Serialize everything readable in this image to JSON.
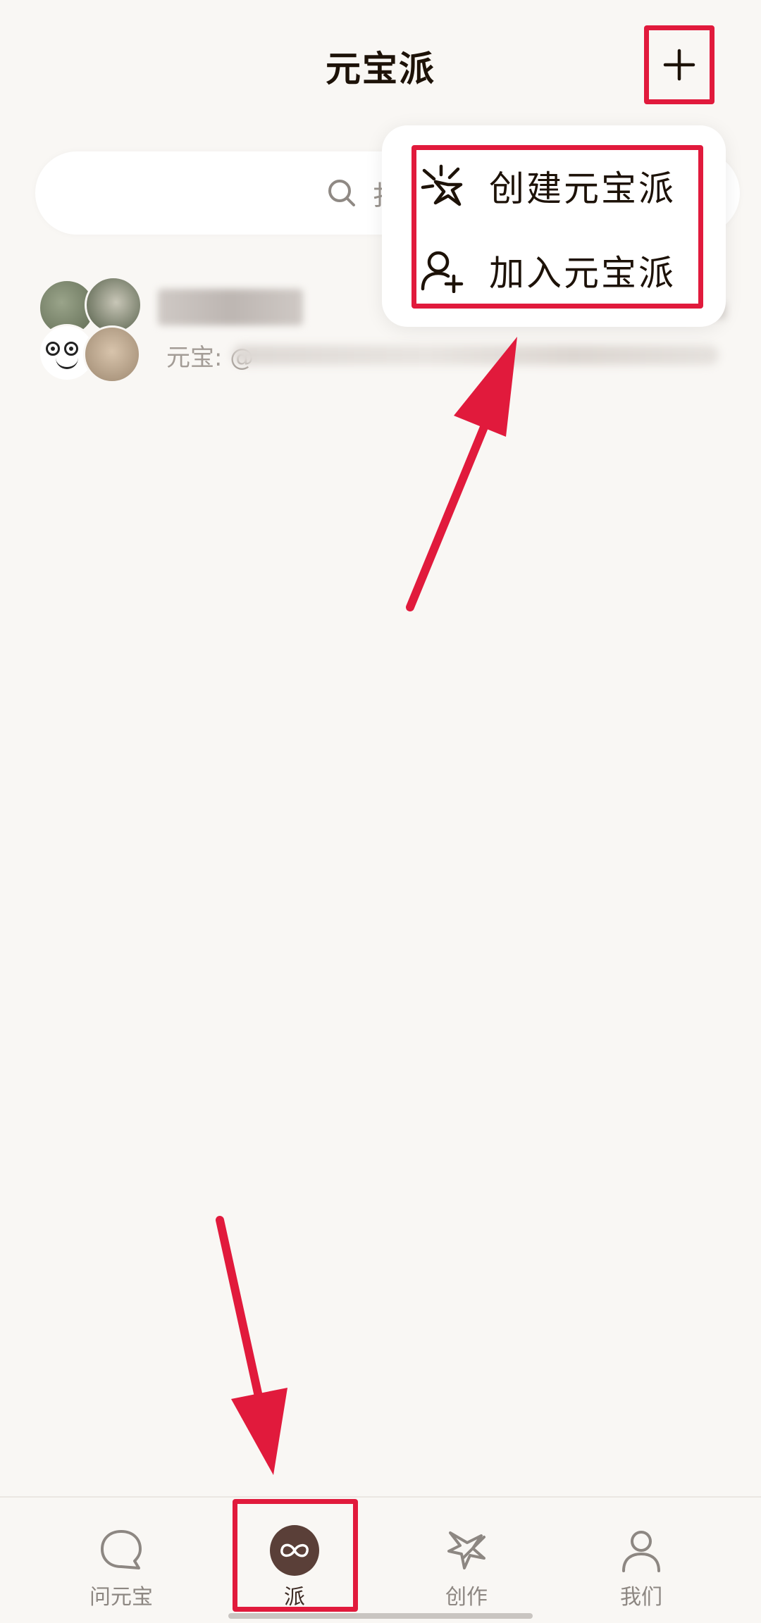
{
  "header": {
    "title": "元宝派",
    "add_icon": "plus-icon"
  },
  "search": {
    "icon": "search-icon",
    "placeholder_visible": "扌"
  },
  "menu": {
    "items": [
      {
        "label": "创建元宝派",
        "icon": "sparkle-burst-icon"
      },
      {
        "label": "加入元宝派",
        "icon": "user-add-icon"
      }
    ]
  },
  "chat_list": {
    "items": [
      {
        "preview_prefix": "元宝: @"
      }
    ]
  },
  "bottom_nav": {
    "items": [
      {
        "label": "问元宝",
        "icon": "chat-bubble-icon",
        "active": false
      },
      {
        "label": "派",
        "icon": "infinity-icon",
        "active": true
      },
      {
        "label": "创作",
        "icon": "pen-star-icon",
        "active": false
      },
      {
        "label": "我们",
        "icon": "person-icon",
        "active": false
      }
    ]
  },
  "colors": {
    "background": "#f9f7f4",
    "annotation_red": "#e11a3c",
    "active_nav": "#5a3f38",
    "inactive_nav": "#8d8782"
  }
}
